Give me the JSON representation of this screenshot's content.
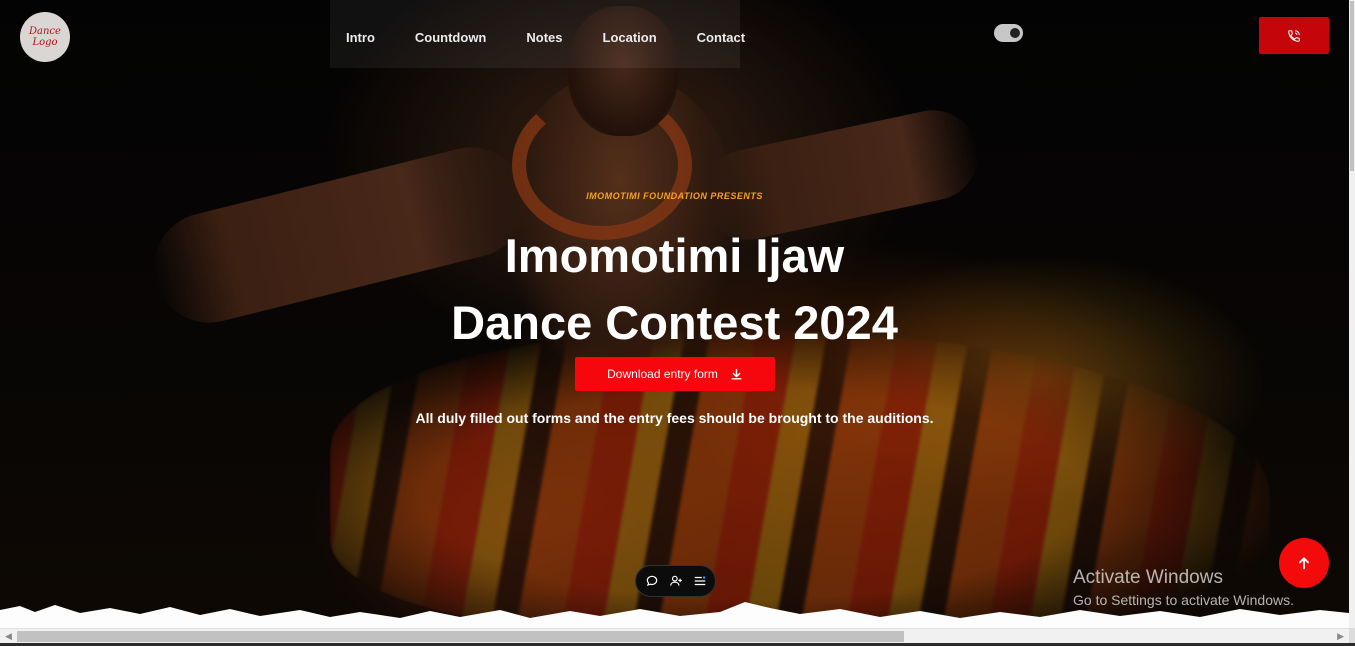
{
  "logo": {
    "line1": "Dance",
    "line2": "Logo"
  },
  "nav": {
    "items": [
      {
        "label": "Intro"
      },
      {
        "label": "Countdown"
      },
      {
        "label": "Notes"
      },
      {
        "label": "Location"
      },
      {
        "label": "Contact"
      }
    ]
  },
  "header": {
    "theme_toggle_icon": "toggle-icon",
    "call_icon": "phone-icon",
    "accent_color": "#c4060a"
  },
  "hero": {
    "eyebrow": "IMOMOTIMI FOUNDATION PRESENTS",
    "title_line1": "Imomotimi Ijaw",
    "title_line2": "Dance Contest 2024",
    "download_label": "Download entry form",
    "download_icon": "download-icon",
    "note": "All duly filled out forms and the entry fees should be brought to the auditions.",
    "button_color": "#f6070d",
    "eyebrow_color": "#f6a21a"
  },
  "dock": {
    "icons": [
      "chat-icon",
      "add-user-icon",
      "settings-list-icon"
    ]
  },
  "watermark": {
    "line1": "Activate Windows",
    "line2": "Go to Settings to activate Windows."
  },
  "scroll_top": {
    "icon": "arrow-up-icon"
  }
}
